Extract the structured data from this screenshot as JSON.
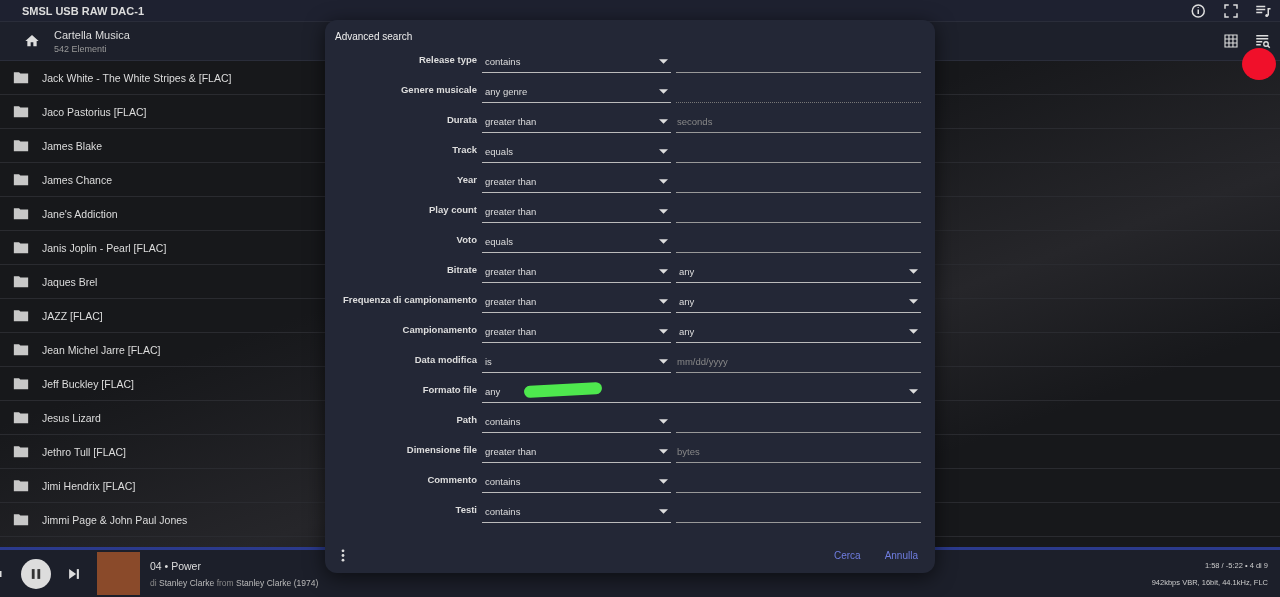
{
  "topbar": {
    "title": "SMSL USB RAW DAC-1"
  },
  "folder": {
    "title": "Cartella Musica",
    "count": "542 Elementi"
  },
  "items": [
    "Jack White - The White Stripes & [FLAC]",
    "Jaco Pastorius [FLAC]",
    "James Blake",
    "James Chance",
    "Jane's Addiction",
    "Janis Joplin - Pearl [FLAC]",
    "Jaques Brel",
    "JAZZ [FLAC]",
    "Jean Michel Jarre [FLAC]",
    "Jeff Buckley [FLAC]",
    "Jesus Lizard",
    "Jethro Tull [FLAC]",
    "Jimi Hendrix [FLAC]",
    "Jimmi Page & John Paul Jones"
  ],
  "dialog": {
    "title": "Advanced search",
    "rows": [
      {
        "label": "Release type",
        "operator": "contains",
        "kind": "text",
        "disabled": false
      },
      {
        "label": "Genere musicale",
        "operator": "any genre",
        "kind": "text",
        "disabled": true
      },
      {
        "label": "Durata",
        "operator": "greater than",
        "kind": "text",
        "disabled": false,
        "placeholder": "seconds"
      },
      {
        "label": "Track",
        "operator": "equals",
        "kind": "text",
        "disabled": false
      },
      {
        "label": "Year",
        "operator": "greater than",
        "kind": "text",
        "disabled": false
      },
      {
        "label": "Play count",
        "operator": "greater than",
        "kind": "text",
        "disabled": false
      },
      {
        "label": "Voto",
        "operator": "equals",
        "kind": "text",
        "disabled": false
      },
      {
        "label": "Bitrate",
        "operator": "greater than",
        "kind": "select",
        "value": "any"
      },
      {
        "label": "Frequenza di campionamento",
        "operator": "greater than",
        "kind": "select",
        "value": "any"
      },
      {
        "label": "Campionamento",
        "operator": "greater than",
        "kind": "select",
        "value": "any"
      },
      {
        "label": "Data modifica",
        "operator": "is",
        "kind": "text",
        "disabled": false,
        "placeholder": "mm/dd/yyyy"
      },
      {
        "label": "Formato file",
        "operator": "any",
        "kind": "wide"
      },
      {
        "label": "Path",
        "operator": "contains",
        "kind": "text",
        "disabled": false
      },
      {
        "label": "Dimensione file",
        "operator": "greater than",
        "kind": "text",
        "disabled": false,
        "placeholder": "bytes"
      },
      {
        "label": "Commento",
        "operator": "contains",
        "kind": "text",
        "disabled": false
      },
      {
        "label": "Testi",
        "operator": "contains",
        "kind": "text",
        "disabled": false
      }
    ],
    "buttons": [
      "Cerca",
      "Annulla"
    ]
  },
  "player": {
    "track": "04 • Power",
    "artist_line": "di **Stanley Clarke** from **Stanley Clarke (1974)**",
    "time": "1:58 / -5:22 • 4 di 9",
    "format": "942kbps VBR, 16bit, 44.1kHz, FLC"
  }
}
